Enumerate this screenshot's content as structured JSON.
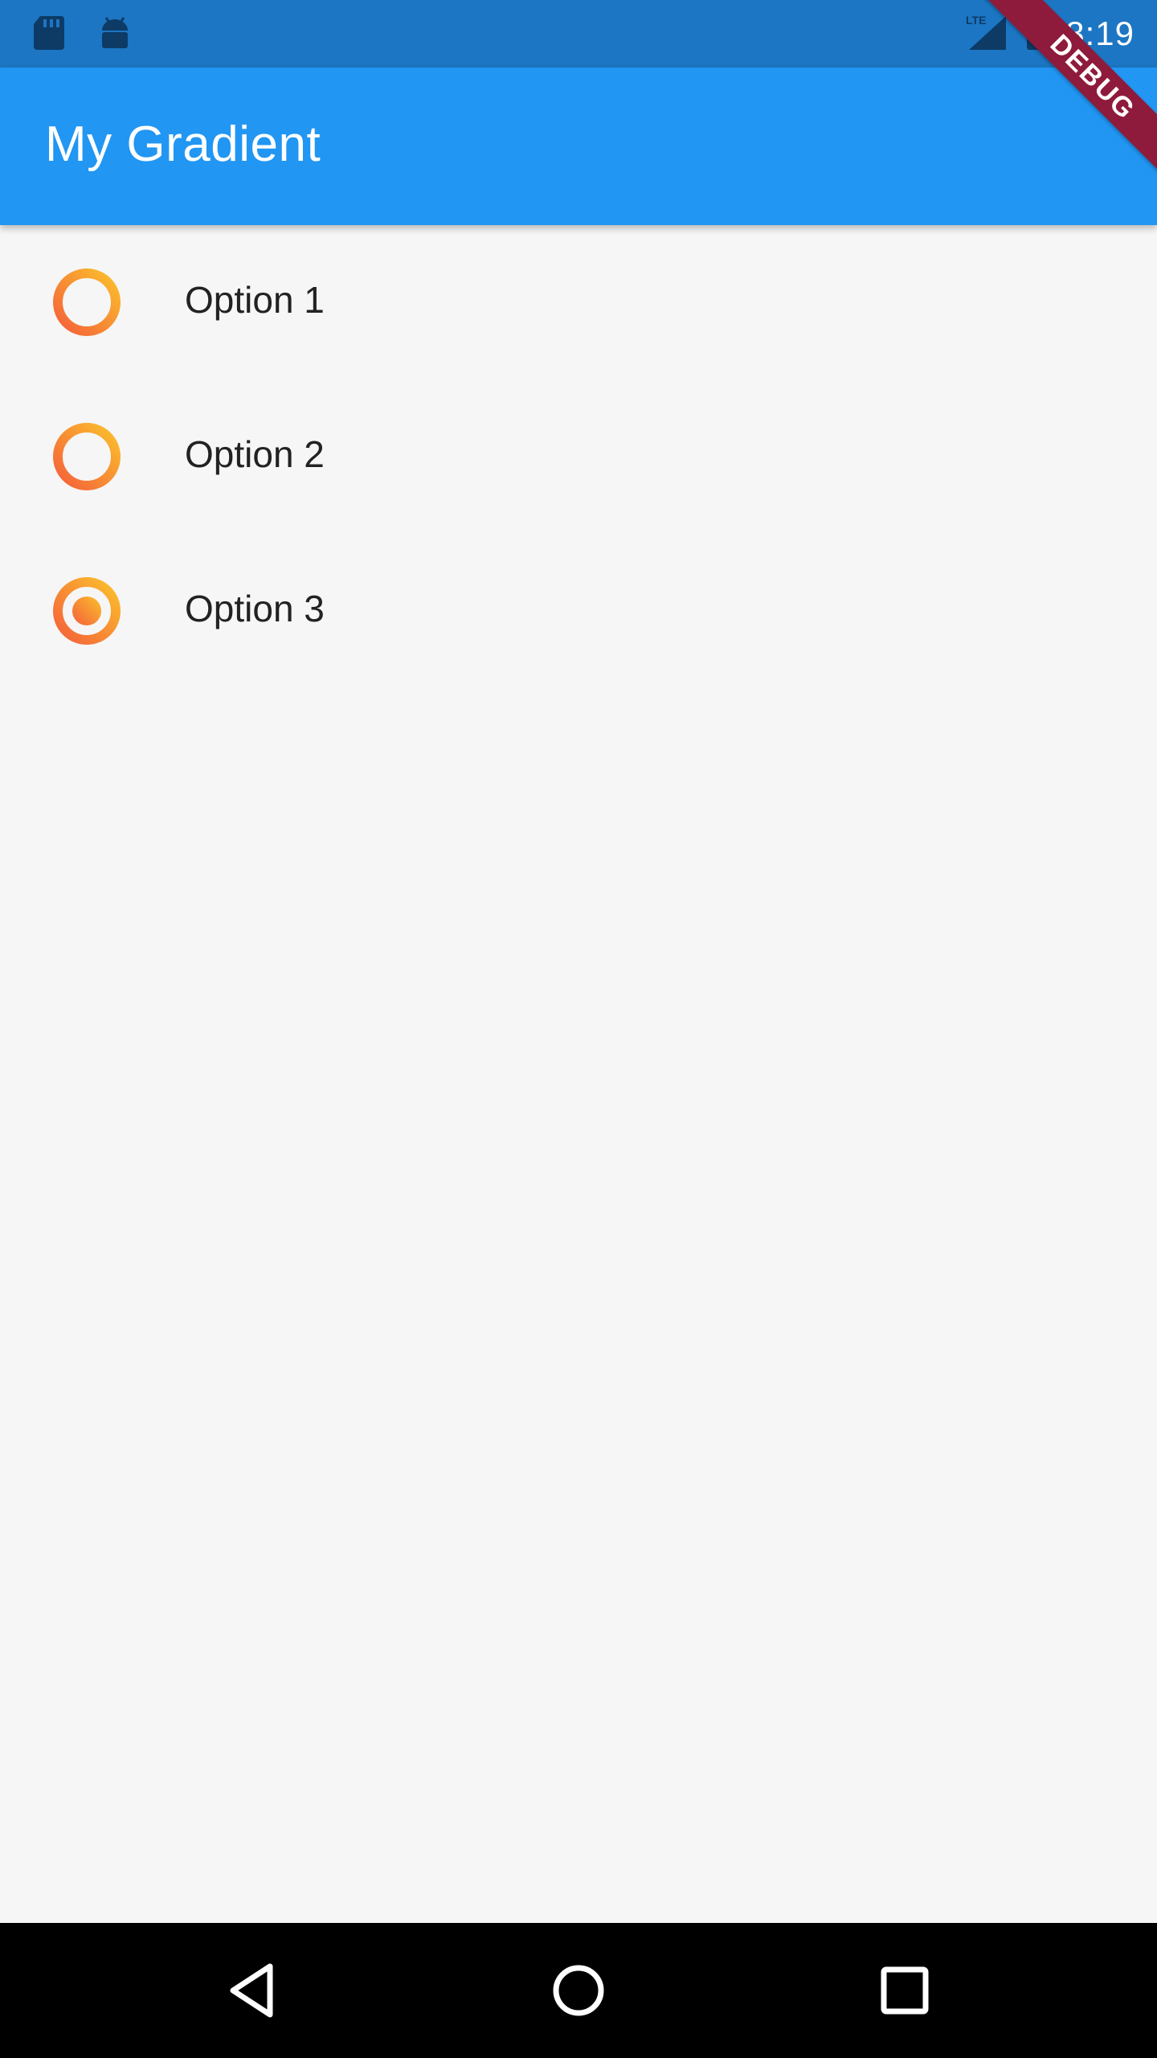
{
  "status_bar": {
    "time": "8:19",
    "network": "LTE",
    "left_icons": [
      "sd-card-icon",
      "android-icon"
    ],
    "right_icons": [
      "lte-signal-icon",
      "battery-icon"
    ],
    "background": "#1c76c3"
  },
  "app_bar": {
    "title": "My Gradient",
    "background": "#2196f3"
  },
  "debug_banner": {
    "label": "DEBUG",
    "color": "#8e1b3c"
  },
  "options": [
    {
      "label": "Option 1",
      "selected": false
    },
    {
      "label": "Option 2",
      "selected": false
    },
    {
      "label": "Option 3",
      "selected": true
    }
  ],
  "radio_gradient": {
    "start": "#f4603a",
    "end": "#fbc02d"
  },
  "nav_bar": {
    "buttons": [
      "back-icon",
      "home-icon",
      "recents-icon"
    ]
  }
}
